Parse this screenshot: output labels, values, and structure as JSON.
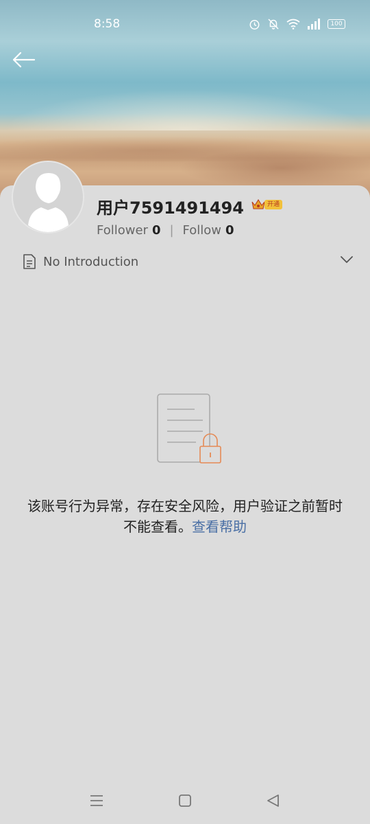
{
  "status_bar": {
    "time": "8:58",
    "battery": "100"
  },
  "profile": {
    "username": "用户7591491494",
    "vip_badge_label": "开通",
    "follower_label": "Follower",
    "follower_count": "0",
    "follow_label": "Follow",
    "follow_count": "0",
    "separator": "|",
    "introduction": "No Introduction"
  },
  "notice": {
    "message": "该账号行为异常，存在安全风险，用户验证之前暂时不能查看。",
    "help_link": "查看帮助"
  },
  "colors": {
    "background": "#dcdcdc",
    "link": "#4a6fa5",
    "lock_accent": "#e58a55"
  },
  "icons": {
    "back": "arrow-left-icon",
    "alarm": "alarm-icon",
    "mute": "bell-off-icon",
    "wifi": "wifi-icon",
    "signal": "signal-icon",
    "battery": "battery-icon",
    "crown": "crown-icon",
    "document": "document-icon",
    "chevron": "chevron-down-icon",
    "lock": "locked-document-icon",
    "menu": "menu-icon",
    "home": "home-square-icon",
    "back_nav": "back-triangle-icon"
  }
}
